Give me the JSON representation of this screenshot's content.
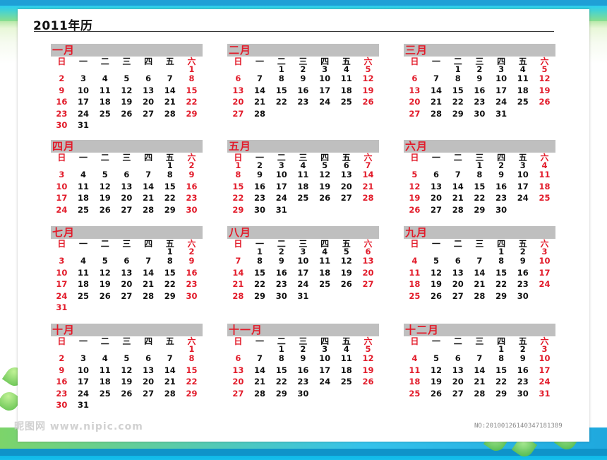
{
  "title": "2011年历",
  "weekdays": [
    "日",
    "一",
    "二",
    "三",
    "四",
    "五",
    "六"
  ],
  "months": [
    {
      "name": "一月",
      "start": 6,
      "days": 31
    },
    {
      "name": "二月",
      "start": 2,
      "days": 28
    },
    {
      "name": "三月",
      "start": 2,
      "days": 31
    },
    {
      "name": "四月",
      "start": 5,
      "days": 30
    },
    {
      "name": "五月",
      "start": 0,
      "days": 31
    },
    {
      "name": "六月",
      "start": 3,
      "days": 30
    },
    {
      "name": "七月",
      "start": 5,
      "days": 31
    },
    {
      "name": "八月",
      "start": 1,
      "days": 31
    },
    {
      "name": "九月",
      "start": 4,
      "days": 30
    },
    {
      "name": "十月",
      "start": 6,
      "days": 31
    },
    {
      "name": "十一月",
      "start": 2,
      "days": 30
    },
    {
      "name": "十二月",
      "start": 4,
      "days": 31
    }
  ],
  "watermark": "昵图网 www.nipic.com",
  "serial": "NO:20100126140347181389",
  "colors": {
    "sunday_saturday": "#e21b2a",
    "header_bar": "#bfbfbf",
    "weekday": "#111111"
  }
}
